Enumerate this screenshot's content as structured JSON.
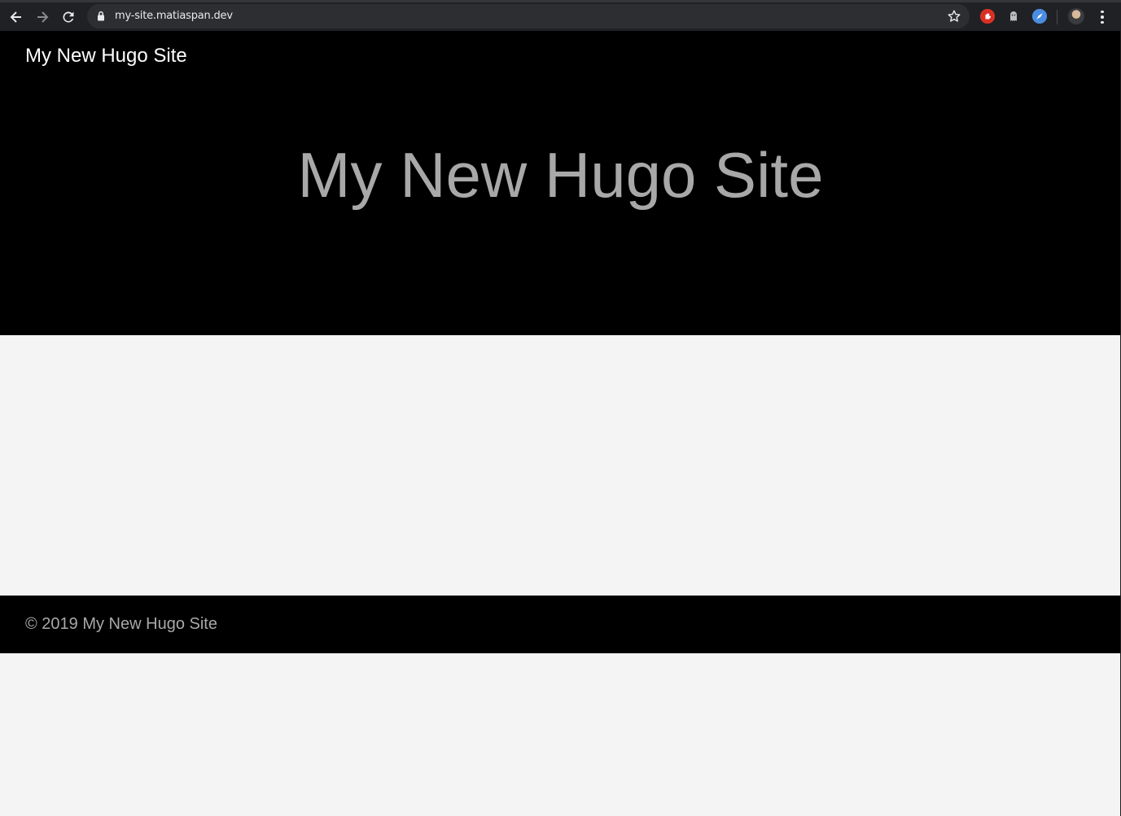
{
  "browser": {
    "url": "my-site.matiaspan.dev",
    "icons": {
      "back": "arrow-left-icon",
      "forward": "arrow-right-icon",
      "reload": "reload-icon",
      "lock": "lock-icon",
      "bookmark": "star-icon",
      "extensions": [
        "stop-hand-extension-icon",
        "ghost-extension-icon",
        "compass-extension-icon"
      ],
      "profile": "profile-avatar",
      "menu": "kebab-menu-icon"
    }
  },
  "site": {
    "brand": "My New Hugo Site",
    "hero_title": "My New Hugo Site",
    "footer": "© 2019 My New Hugo Site"
  },
  "colors": {
    "header_bg": "#000000",
    "page_bg": "#f4f4f4",
    "hero_text": "#a8a8a8",
    "brand_text": "#ffffff",
    "chrome_bg": "#202124"
  }
}
